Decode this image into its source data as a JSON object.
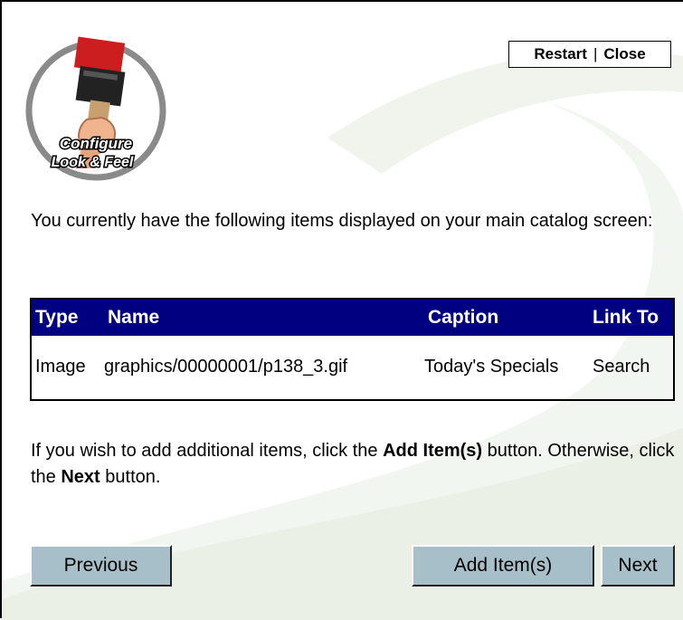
{
  "header": {
    "logo_text_line1": "Configure",
    "logo_text_line2": "Look & Feel",
    "restart_label": "Restart",
    "separator": "|",
    "close_label": "Close"
  },
  "intro_text": "You currently have the following items displayed on your main catalog screen:",
  "table": {
    "columns": [
      "Type",
      "Name",
      "Caption",
      "Link To"
    ],
    "rows": [
      {
        "type": "Image",
        "name": "graphics/00000001/p138_3.gif",
        "caption": "Today's Specials",
        "link_to": "Search"
      }
    ]
  },
  "instructions": {
    "part1": "If you wish to add additional items, click the ",
    "bold1": "Add Item(s)",
    "part2": " button. Otherwise, click the ",
    "bold2": "Next",
    "part3": " button."
  },
  "buttons": {
    "previous": "Previous",
    "add_items": "Add Item(s)",
    "next": "Next"
  },
  "colors": {
    "table_header_bg": "#000080",
    "button_bg": "#a7bfc9",
    "swoosh": "#eef3ea"
  }
}
